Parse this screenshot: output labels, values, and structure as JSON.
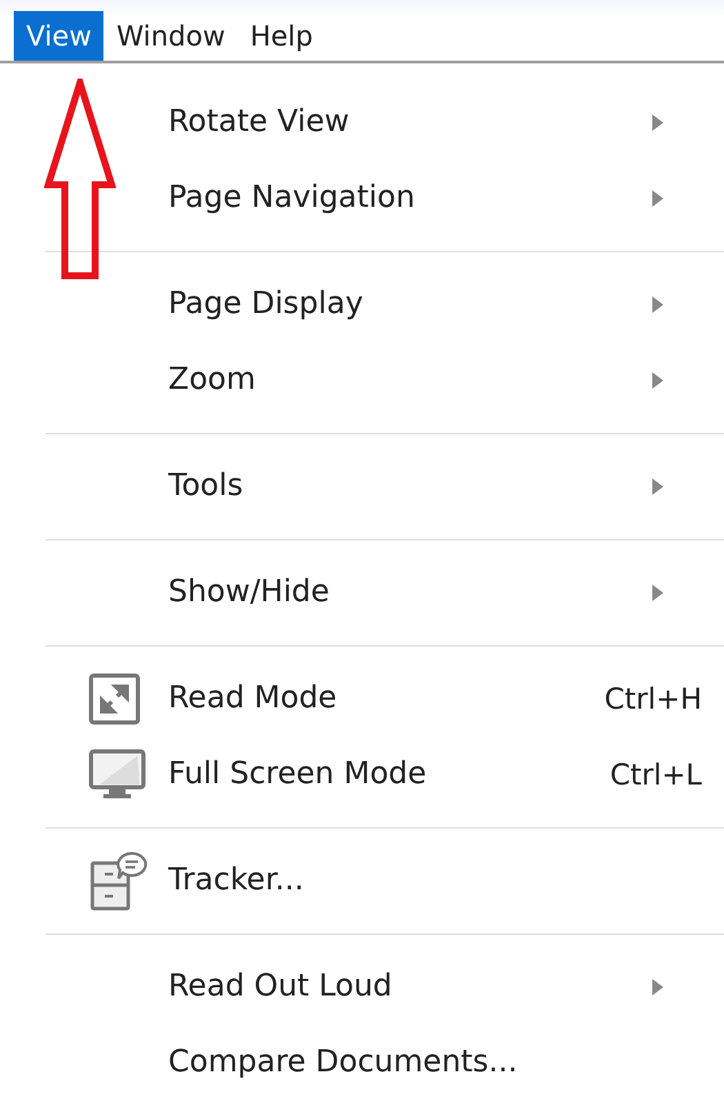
{
  "menubar": [
    {
      "label": "View",
      "selected": true
    },
    {
      "label": "Window",
      "selected": false
    },
    {
      "label": "Help",
      "selected": false
    }
  ],
  "annotation": {
    "kind": "arrow"
  },
  "menu": {
    "groups": [
      [
        {
          "label": "Rotate View",
          "kind": "plain",
          "submenu": true
        },
        {
          "label": "Page Navigation",
          "kind": "plain",
          "submenu": true
        }
      ],
      [
        {
          "label": "Page Display",
          "kind": "plain",
          "submenu": true
        },
        {
          "label": "Zoom",
          "kind": "plain",
          "submenu": true
        }
      ],
      [
        {
          "label": "Tools",
          "kind": "plain",
          "submenu": true
        }
      ],
      [
        {
          "label": "Show/Hide",
          "kind": "plain",
          "submenu": true
        }
      ],
      [
        {
          "label": "Read Mode",
          "kind": "read_mode",
          "shortcut": "Ctrl+H",
          "submenu": false
        },
        {
          "label": "Full Screen Mode",
          "kind": "full_screen",
          "shortcut": "Ctrl+L",
          "submenu": false
        }
      ],
      [
        {
          "label": "Tracker...",
          "kind": "tracker",
          "submenu": false
        }
      ],
      [
        {
          "label": "Read Out Loud",
          "kind": "plain",
          "submenu": true
        },
        {
          "label": "Compare Documents...",
          "kind": "plain",
          "submenu": false
        }
      ]
    ]
  }
}
